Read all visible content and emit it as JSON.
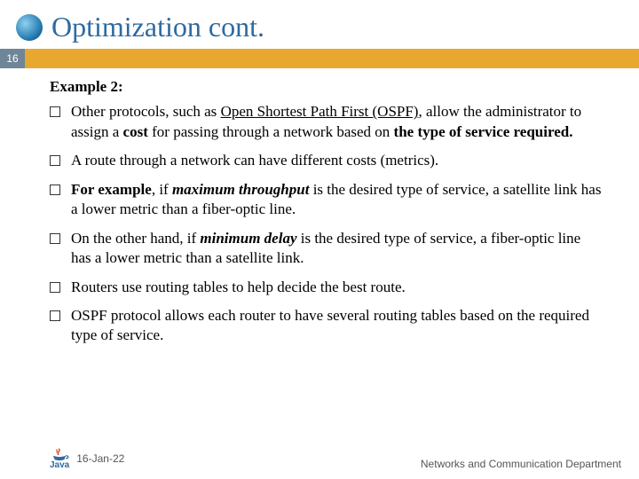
{
  "header": {
    "title": "Optimization cont."
  },
  "page_number": "16",
  "content": {
    "example_label": "Example 2:",
    "bullets": [
      {
        "pre": "Other protocols, such as ",
        "ospf": "Open Shortest Path First (OSPF)",
        "mid1": ", allow the administrator to assign a ",
        "cost": "cost",
        "mid2": " for passing through a network based on ",
        "tos": "the type of service required.",
        "rest": ""
      },
      {
        "text": "A route through a network can have different costs (metrics)."
      },
      {
        "pre": "For example",
        "mid1": ", if ",
        "em": "maximum throughput",
        "rest": " is the desired type of service, a satellite link has a lower metric than a fiber-optic line."
      },
      {
        "pre": "On the other hand, if ",
        "em": "minimum delay",
        "rest": " is the desired type of service, a fiber-optic line has a lower metric than a satellite link."
      },
      {
        "text": "Routers use routing tables to help decide the best route."
      },
      {
        "text": "OSPF protocol allows each router to have several routing tables based on the required type of service."
      }
    ]
  },
  "footer": {
    "date": "16-Jan-22",
    "dept": "Networks and Communication Department",
    "java_label": "Java"
  }
}
